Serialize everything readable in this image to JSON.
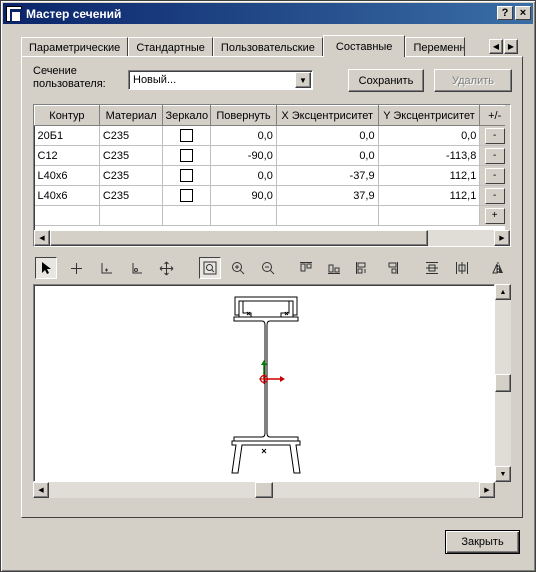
{
  "window": {
    "title": "Мастер сечений",
    "help_label": "?",
    "close_label": "×"
  },
  "tabs": [
    {
      "label": "Параметрические",
      "active": false
    },
    {
      "label": "Стандартные",
      "active": false
    },
    {
      "label": "Пользовательские",
      "active": false
    },
    {
      "label": "Составные",
      "active": true
    },
    {
      "label": "Переменн",
      "active": false
    }
  ],
  "form": {
    "section_label": "Сечение\nпользователя:",
    "section_value": "Новый...",
    "save_label": "Сохранить",
    "delete_label": "Удалить"
  },
  "table": {
    "columns": [
      "Контур",
      "Материал",
      "Зеркало",
      "Повернуть",
      "X Эксцентриситет",
      "Y Эксцентриситет",
      "+/-"
    ],
    "rows": [
      {
        "contour": "20Б1",
        "material": "C235",
        "mirror": false,
        "rotate": "0,0",
        "x_ecc": "0,0",
        "y_ecc": "0,0",
        "action": "-"
      },
      {
        "contour": "C12",
        "material": "C235",
        "mirror": false,
        "rotate": "-90,0",
        "x_ecc": "0,0",
        "y_ecc": "-113,8",
        "action": "-"
      },
      {
        "contour": "L40x6",
        "material": "C235",
        "mirror": false,
        "rotate": "0,0",
        "x_ecc": "-37,9",
        "y_ecc": "112,1",
        "action": "-"
      },
      {
        "contour": "L40x6",
        "material": "C235",
        "mirror": false,
        "rotate": "90,0",
        "x_ecc": "37,9",
        "y_ecc": "112,1",
        "action": "-"
      }
    ],
    "add_label": "+"
  },
  "toolbar_icons": [
    "select-arrow-icon",
    "crosshair-icon",
    "origin-axes-icon",
    "axes-alt-icon",
    "pan-icon",
    "zoom-fit-icon",
    "zoom-in-icon",
    "zoom-out-icon",
    "align-top-icon",
    "align-bottom-icon",
    "align-left-icon",
    "align-right-icon",
    "center-vertical-icon",
    "center-horizontal-icon",
    "mirror-icon"
  ],
  "footer": {
    "close_label": "Закрыть"
  },
  "colors": {
    "title_start": "#0a246a",
    "title_end": "#3a6ea5",
    "axis_x": "#cc0000",
    "axis_y": "#008000"
  }
}
